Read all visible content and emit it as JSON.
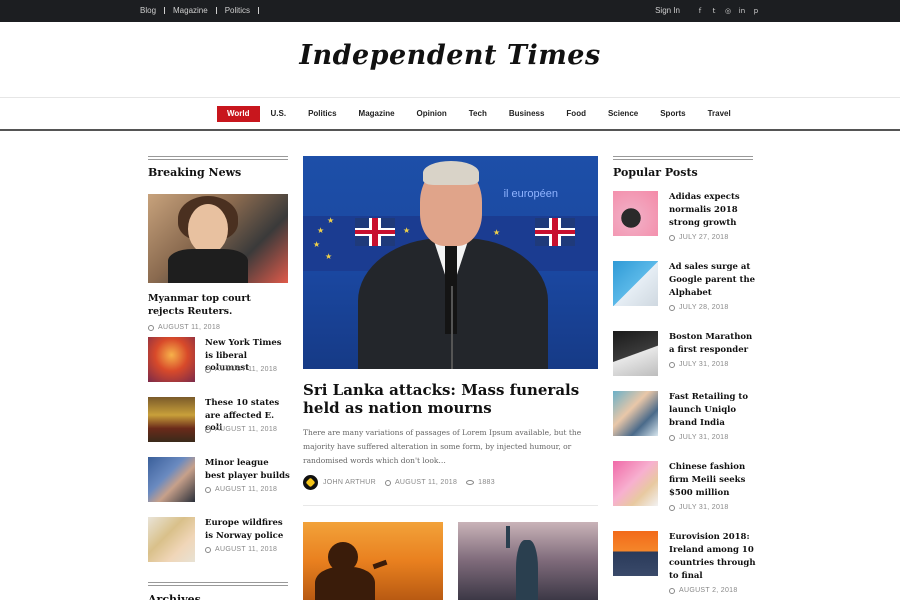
{
  "topbar": {
    "links": [
      "Blog",
      "Magazine",
      "Politics"
    ],
    "sign_in": "Sign In",
    "social_icons": [
      "facebook-icon",
      "twitter-icon",
      "instagram-icon",
      "linkedin-icon",
      "pinterest-icon"
    ]
  },
  "masthead": {
    "logo": "Independent Times"
  },
  "nav": {
    "items": [
      "World",
      "U.S.",
      "Politics",
      "Magazine",
      "Opinion",
      "Tech",
      "Business",
      "Food",
      "Science",
      "Sports",
      "Travel"
    ],
    "active": "World",
    "active_color": "#c8161d"
  },
  "breaking": {
    "heading": "Breaking News",
    "feature": {
      "title": "Myanmar top court rejects Reuters.",
      "date": "AUGUST 11, 2018"
    },
    "items": [
      {
        "title": "New York Times is liberal columnst",
        "date": "AUGUST 11, 2018"
      },
      {
        "title": "These 10 states are affected E. coli",
        "date": "AUGUST 11, 2018"
      },
      {
        "title": "Minor league best player builds",
        "date": "AUGUST 11, 2018"
      },
      {
        "title": "Europe wildfires is Norway police",
        "date": "AUGUST 11, 2018"
      }
    ],
    "archives_heading": "Archives"
  },
  "main": {
    "image_text": "il européen",
    "title": "Sri Lanka attacks: Mass funerals held as nation mourns",
    "excerpt": "There are many variations of passages of Lorem Ipsum available, but the majority have suffered alteration in some form, by injected humour, or randomised words which don't look…",
    "author": "JOHN ARTHUR",
    "date": "AUGUST 11, 2018",
    "views": "1883"
  },
  "popular": {
    "heading": "Popular Posts",
    "items": [
      {
        "title": "Adidas expects normalis 2018 strong growth",
        "date": "JULY 27, 2018"
      },
      {
        "title": "Ad sales surge at Google parent the Alphabet",
        "date": "JULY 28, 2018"
      },
      {
        "title": "Boston Marathon a first responder",
        "date": "JULY 31, 2018"
      },
      {
        "title": "Fast Retailing to launch Uniqlo brand India",
        "date": "JULY 31, 2018"
      },
      {
        "title": "Chinese fashion firm Meili seeks $500 million",
        "date": "JULY 31, 2018"
      },
      {
        "title": "Eurovision 2018: Ireland among 10 countries through to final",
        "date": "AUGUST 2, 2018"
      }
    ]
  }
}
